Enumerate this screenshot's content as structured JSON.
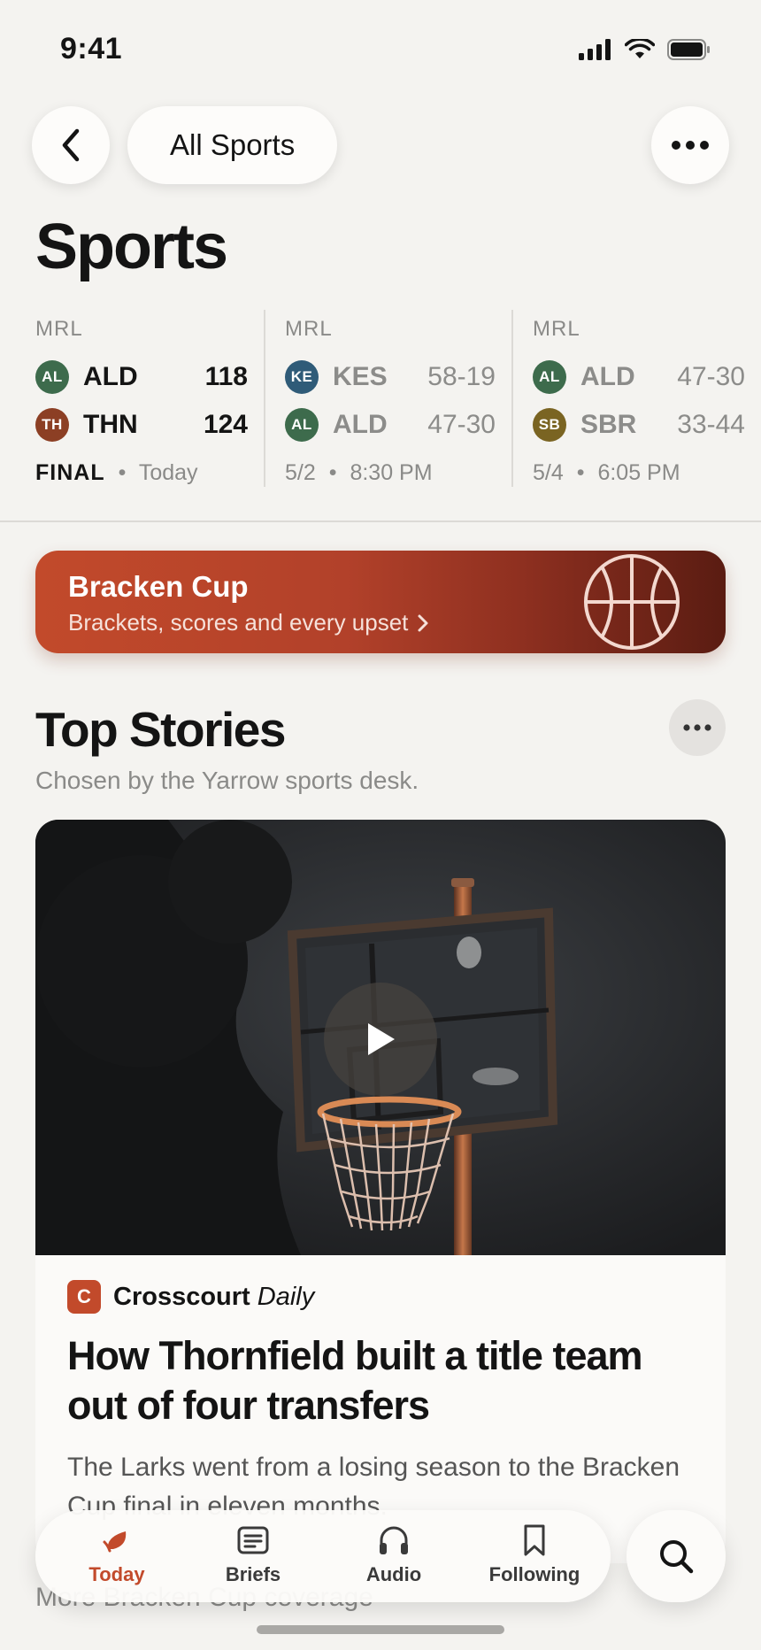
{
  "status_bar": {
    "time": "9:41"
  },
  "nav": {
    "filter_label": "All Sports"
  },
  "page": {
    "title": "Sports"
  },
  "games": [
    {
      "league": "MRL",
      "teams": [
        {
          "logo": "AL",
          "abbr": "ALD",
          "score": "118",
          "color": "#3d6b4c"
        },
        {
          "logo": "TH",
          "abbr": "THN",
          "score": "124",
          "color": "#8c3f24"
        }
      ],
      "status": "FINAL",
      "when": "Today"
    },
    {
      "league": "MRL",
      "teams": [
        {
          "logo": "KE",
          "abbr": "KES",
          "score": "58-19",
          "color": "#2f5b78"
        },
        {
          "logo": "AL",
          "abbr": "ALD",
          "score": "47-30",
          "color": "#3d6b4c"
        }
      ],
      "date": "5/2",
      "time": "8:30 PM"
    },
    {
      "league": "MRL",
      "teams": [
        {
          "logo": "AL",
          "abbr": "ALD",
          "score": "47-30",
          "color": "#3d6b4c"
        },
        {
          "logo": "SB",
          "abbr": "SBR",
          "score": "33-44",
          "color": "#7a6422"
        }
      ],
      "date": "5/4",
      "time": "6:05 PM"
    }
  ],
  "promo": {
    "title": "Bracken Cup",
    "subtitle": "Brackets, scores and every upset",
    "color": "#c24a2b"
  },
  "top_stories": {
    "title": "Top Stories",
    "subtitle": "Chosen by the Yarrow sports desk.",
    "story": {
      "publisher_logo": "C",
      "publisher": "Crosscourt",
      "publisher_suffix": "Daily",
      "headline": "How Thornfield built a title team out of four transfers",
      "dek": "The Larks went from a losing season to the Bracken Cup final in eleven months."
    }
  },
  "more_coverage": "More Bracken Cup coverage",
  "tabs": [
    {
      "label": "Today",
      "icon": "leaf-icon",
      "active": true
    },
    {
      "label": "Briefs",
      "icon": "briefs-icon"
    },
    {
      "label": "Audio",
      "icon": "headphones-icon"
    },
    {
      "label": "Following",
      "icon": "bookmark-icon"
    }
  ],
  "accent_color": "#c24a2b"
}
